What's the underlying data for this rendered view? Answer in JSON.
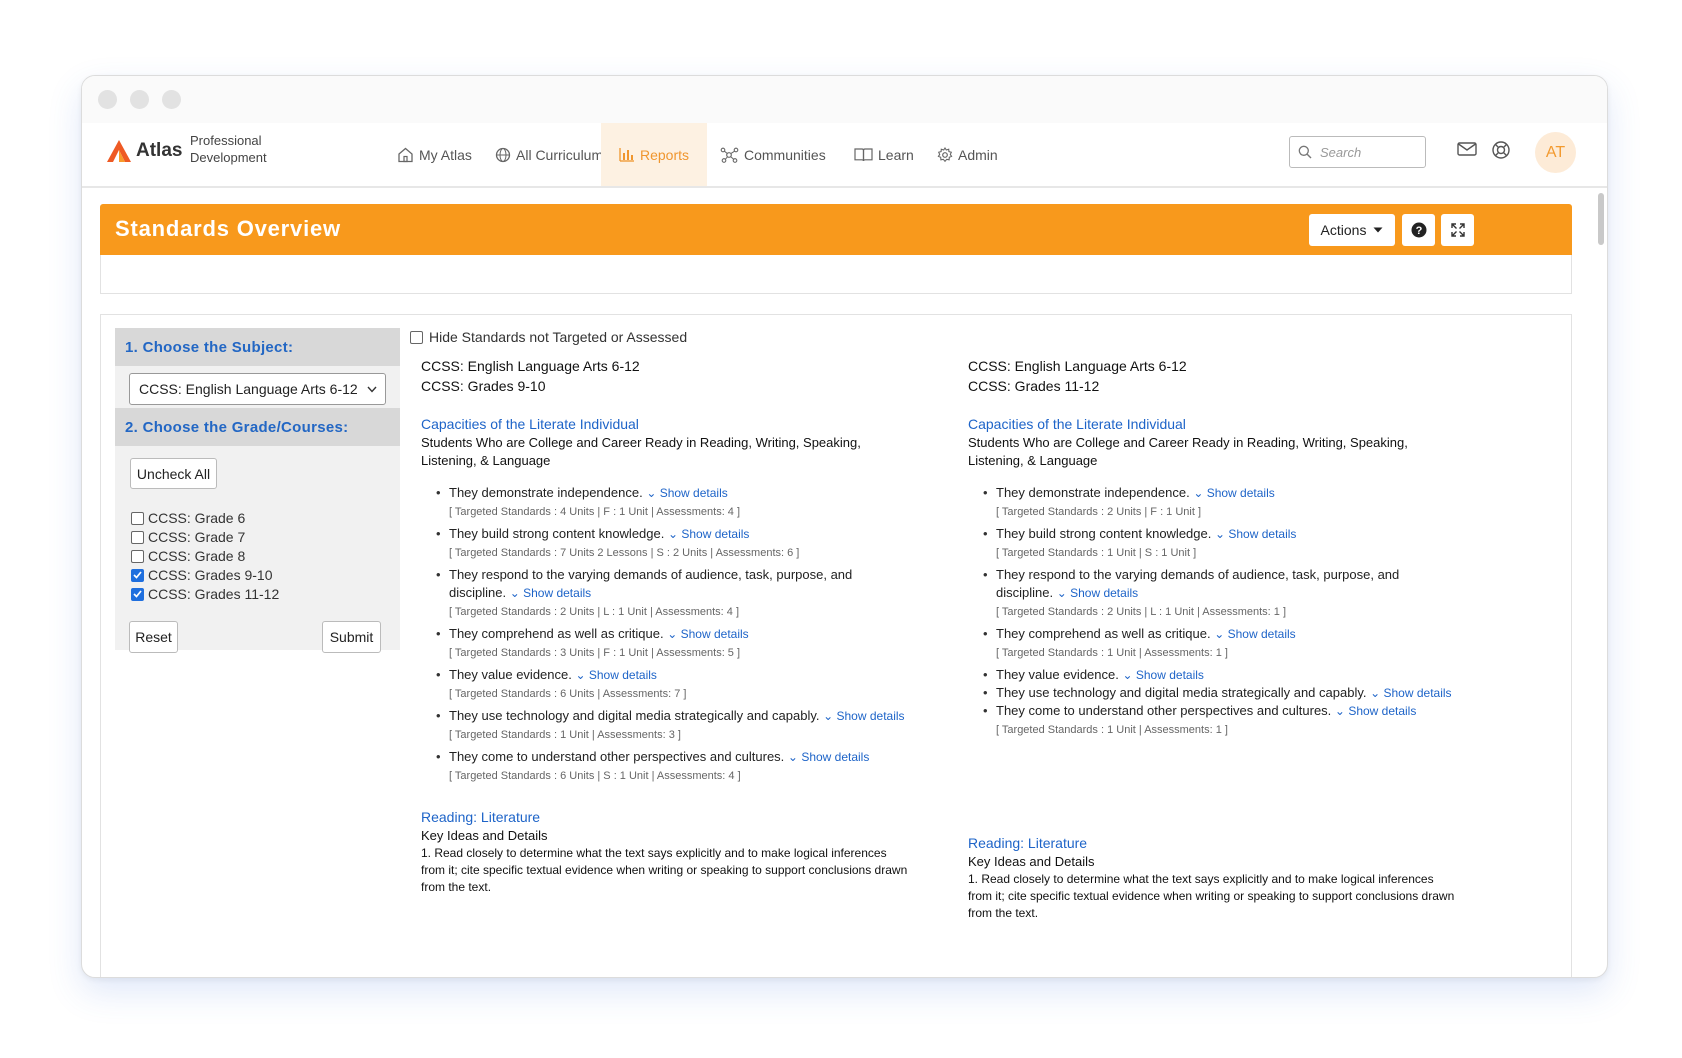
{
  "app": {
    "brand": "Atlas",
    "brand_sub": "Professional Development",
    "nav": [
      {
        "label": "My Atlas",
        "icon": "home-icon"
      },
      {
        "label": "All Curriculum",
        "icon": "globe-icon"
      },
      {
        "label": "Reports",
        "icon": "bar-chart-icon",
        "active": true
      },
      {
        "label": "Communities",
        "icon": "network-icon"
      },
      {
        "label": "Learn",
        "icon": "book-icon"
      },
      {
        "label": "Admin",
        "icon": "gear-icon"
      }
    ],
    "search_placeholder": "Search",
    "avatar": "AT",
    "accent": "#f8991c",
    "link_color": "#1e64c8"
  },
  "page": {
    "title": "Standards Overview",
    "actions_label": "Actions"
  },
  "sidebar": {
    "step1": "1. Choose the Subject:",
    "subject": "CCSS: English Language Arts 6-12",
    "step2": "2. Choose the Grade/Courses:",
    "uncheck_all": "Uncheck All",
    "grades": [
      {
        "label": "CCSS: Grade 6",
        "checked": false
      },
      {
        "label": "CCSS: Grade 7",
        "checked": false
      },
      {
        "label": "CCSS: Grade 8",
        "checked": false
      },
      {
        "label": "CCSS: Grades 9-10",
        "checked": true
      },
      {
        "label": "CCSS: Grades 11-12",
        "checked": true
      }
    ],
    "reset": "Reset",
    "submit": "Submit"
  },
  "main": {
    "hide_label": "Hide Standards not Targeted or Assessed",
    "show_details": "Show details",
    "columns": [
      {
        "subject": "CCSS: English Language Arts 6-12",
        "grade": "CCSS: Grades 9-10",
        "section1_title": "Capacities of the Literate Individual",
        "section1_desc": "Students Who are College and Career Ready in Reading, Writing, Speaking, Listening, & Language",
        "items": [
          {
            "text": "They demonstrate independence.",
            "stats": "[ Targeted Standards : 4 Units | F : 1 Unit | Assessments: 4 ]"
          },
          {
            "text": "They build strong content knowledge.",
            "stats": "[ Targeted Standards : 7 Units 2 Lessons | S : 2 Units | Assessments: 6 ]"
          },
          {
            "text": "They respond to the varying demands of audience, task, purpose, and discipline.",
            "stats": "[ Targeted Standards : 2 Units | L : 1 Unit | Assessments: 4 ]"
          },
          {
            "text": "They comprehend as well as critique.",
            "stats": "[ Targeted Standards : 3 Units | F : 1 Unit | Assessments: 5 ]"
          },
          {
            "text": "They value evidence.",
            "stats": "[ Targeted Standards : 6 Units | Assessments: 7 ]"
          },
          {
            "text": "They use technology and digital media strategically and capably.",
            "stats": "[ Targeted Standards : 1 Unit | Assessments: 3 ]"
          },
          {
            "text": "They come to understand other perspectives and cultures.",
            "stats": "[ Targeted Standards : 6 Units | S : 1 Unit | Assessments: 4 ]"
          }
        ],
        "section2_title": "Reading: Literature",
        "section2_sub": "Key Ideas and Details",
        "section2_text": "1. Read closely to determine what the text says explicitly and to make logical inferences from it; cite specific textual evidence when writing or speaking to support conclusions drawn from the text."
      },
      {
        "subject": "CCSS: English Language Arts 6-12",
        "grade": "CCSS: Grades 11-12",
        "section1_title": "Capacities of the Literate Individual",
        "section1_desc": "Students Who are College and Career Ready in Reading, Writing, Speaking, Listening, & Language",
        "items": [
          {
            "text": "They demonstrate independence.",
            "stats": "[ Targeted Standards : 2 Units | F : 1 Unit ]"
          },
          {
            "text": "They build strong content knowledge.",
            "stats": "[ Targeted Standards : 1 Unit | S : 1 Unit ]"
          },
          {
            "text": "They respond to the varying demands of audience, task, purpose, and discipline.",
            "stats": "[ Targeted Standards : 2 Units | L : 1 Unit | Assessments: 1 ]"
          },
          {
            "text": "They comprehend as well as critique.",
            "stats": "[ Targeted Standards : 1 Unit | Assessments: 1 ]"
          },
          {
            "text": "They value evidence.",
            "stats": ""
          },
          {
            "text": "They use technology and digital media strategically and capably.",
            "stats": ""
          },
          {
            "text": "They come to understand other perspectives and cultures.",
            "stats": "[ Targeted Standards : 1 Unit | Assessments: 1 ]"
          }
        ],
        "section2_title": "Reading: Literature",
        "section2_sub": "Key Ideas and Details",
        "section2_text": "1. Read closely to determine what the text says explicitly and to make logical inferences from it; cite specific textual evidence when writing or speaking to support conclusions drawn from the text."
      }
    ]
  }
}
